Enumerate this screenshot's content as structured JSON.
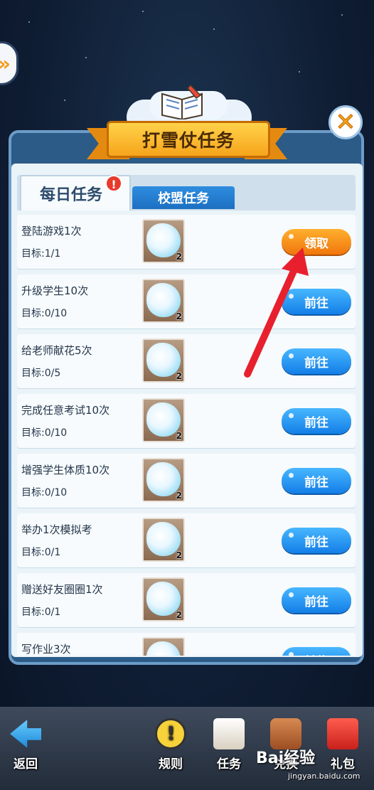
{
  "header": {
    "title": "打雪仗任务",
    "close_glyph": "✕"
  },
  "tabs": {
    "daily": "每日任务",
    "daily_alert": "!",
    "league": "校盟任务"
  },
  "tasks": [
    {
      "name": "登陆游戏1次",
      "goal": "目标:1/1",
      "reward_qty": "2",
      "action": "领取",
      "state": "claim"
    },
    {
      "name": "升级学生10次",
      "goal": "目标:0/10",
      "reward_qty": "2",
      "action": "前往",
      "state": "go"
    },
    {
      "name": "给老师献花5次",
      "goal": "目标:0/5",
      "reward_qty": "2",
      "action": "前往",
      "state": "go"
    },
    {
      "name": "完成任意考试10次",
      "goal": "目标:0/10",
      "reward_qty": "2",
      "action": "前往",
      "state": "go"
    },
    {
      "name": "增强学生体质10次",
      "goal": "目标:0/10",
      "reward_qty": "2",
      "action": "前往",
      "state": "go"
    },
    {
      "name": "举办1次模拟考",
      "goal": "目标:0/1",
      "reward_qty": "2",
      "action": "前往",
      "state": "go"
    },
    {
      "name": "赠送好友圈圈1次",
      "goal": "目标:0/1",
      "reward_qty": "2",
      "action": "前往",
      "state": "go"
    },
    {
      "name": "写作业3次",
      "goal": "",
      "reward_qty": "",
      "action": "前往",
      "state": "go"
    }
  ],
  "bottom_nav": {
    "back": "返回",
    "rules": "规则",
    "tasks": "任务",
    "exchange": "兑换",
    "gift": "礼包"
  },
  "watermark": {
    "brand": "Bai经验",
    "url": "jingyan.baidu.com"
  },
  "colors": {
    "claim_button": "#f0760d",
    "go_button": "#137ee7",
    "tutorial_arrow": "#e8202e"
  }
}
